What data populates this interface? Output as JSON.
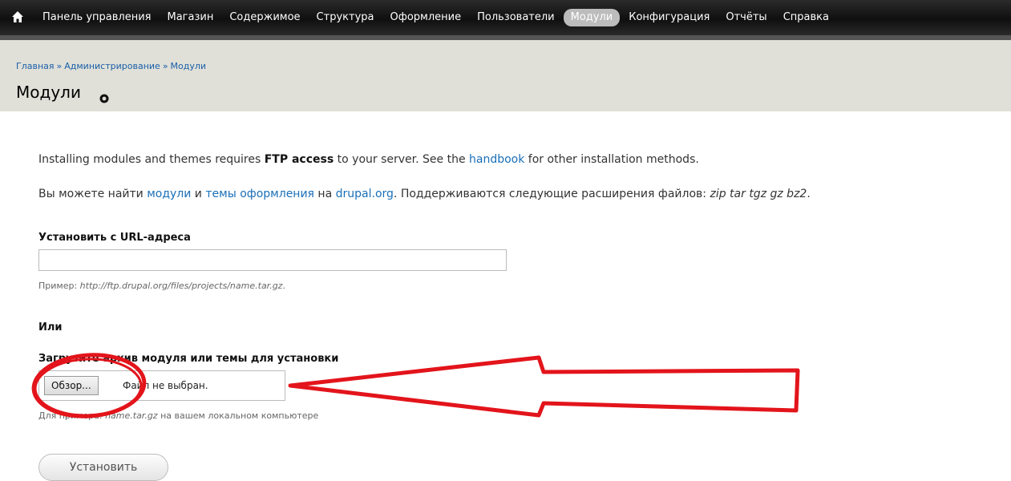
{
  "toolbar": {
    "home_icon": "home-icon",
    "items": [
      {
        "label": "Панель управления"
      },
      {
        "label": "Магазин"
      },
      {
        "label": "Содержимое"
      },
      {
        "label": "Структура"
      },
      {
        "label": "Оформление"
      },
      {
        "label": "Пользователи"
      },
      {
        "label": "Модули",
        "active": true
      },
      {
        "label": "Конфигурация"
      },
      {
        "label": "Отчёты"
      },
      {
        "label": "Справка"
      }
    ]
  },
  "breadcrumb": {
    "items": [
      "Главная",
      "Администрирование",
      "Модули"
    ],
    "separator": "»"
  },
  "page": {
    "title": "Модули",
    "add_shortcut_icon": "plus-circle-icon"
  },
  "intro": {
    "p1_a": "Installing modules and themes requires ",
    "p1_b": "FTP access",
    "p1_c": " to your server. See the ",
    "p1_link": "handbook",
    "p1_d": " for other installation methods.",
    "p2_a": "Вы можете найти ",
    "p2_link1": "модули",
    "p2_b": " и ",
    "p2_link2": "темы оформления",
    "p2_c": " на ",
    "p2_link3": "drupal.org",
    "p2_d": ". Поддерживаются следующие расширения файлов: ",
    "p2_ext": "zip tar tgz gz bz2",
    "p2_e": "."
  },
  "url_field": {
    "label": "Установить с URL-адреса",
    "value": "",
    "desc_prefix": "Пример: ",
    "desc_example": "http://ftp.drupal.org/files/projects/name.tar.gz",
    "desc_suffix": "."
  },
  "or_label": "Или",
  "upload_field": {
    "label": "Загрузите архив модуля или темы для установки",
    "browse_label": "Обзор...",
    "file_status": "Файл не выбран.",
    "desc_prefix": "Для примера: ",
    "desc_example": "name.tar.gz",
    "desc_suffix": " на вашем локальном компьютере"
  },
  "install_button": "Установить",
  "colors": {
    "annotation": "#e3141b",
    "link": "#1a6fb8",
    "header_bg": "#e0e0d8",
    "toolbar_bg": "#1a1a1a"
  }
}
